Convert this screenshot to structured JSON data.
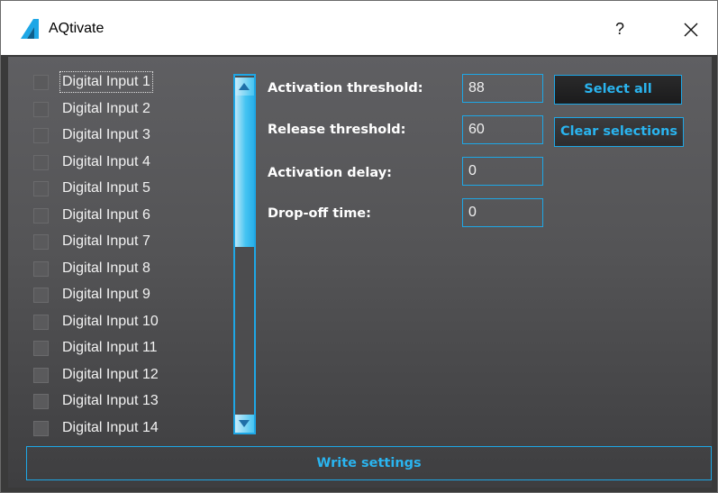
{
  "window": {
    "title": "AQtivate",
    "help_label": "?",
    "logo_icon": "aqtivate-logo-icon",
    "close_icon": "close-icon",
    "accent_color": "#1ea7e6"
  },
  "inputs": {
    "items": [
      {
        "label": "Digital Input 1",
        "checked": false,
        "focused": true
      },
      {
        "label": "Digital Input 2",
        "checked": false
      },
      {
        "label": "Digital Input 3",
        "checked": false
      },
      {
        "label": "Digital Input 4",
        "checked": false
      },
      {
        "label": "Digital Input 5",
        "checked": false
      },
      {
        "label": "Digital Input 6",
        "checked": false
      },
      {
        "label": "Digital Input 7",
        "checked": false
      },
      {
        "label": "Digital Input 8",
        "checked": false
      },
      {
        "label": "Digital Input 9",
        "checked": false
      },
      {
        "label": "Digital Input 10",
        "checked": false
      },
      {
        "label": "Digital Input 11",
        "checked": false
      },
      {
        "label": "Digital Input 12",
        "checked": false
      },
      {
        "label": "Digital Input 13",
        "checked": false
      },
      {
        "label": "Digital Input 14",
        "checked": false
      }
    ]
  },
  "settings": {
    "activation_threshold": {
      "label": "Activation threshold:",
      "value": "88"
    },
    "release_threshold": {
      "label": "Release threshold:",
      "value": "60"
    },
    "activation_delay": {
      "label": "Activation delay:",
      "value": "0"
    },
    "drop_off_time": {
      "label": "Drop-off time:",
      "value": "0"
    }
  },
  "actions": {
    "select_all": "Select all",
    "clear_selections": "Clear selections",
    "write_settings": "Write settings"
  }
}
